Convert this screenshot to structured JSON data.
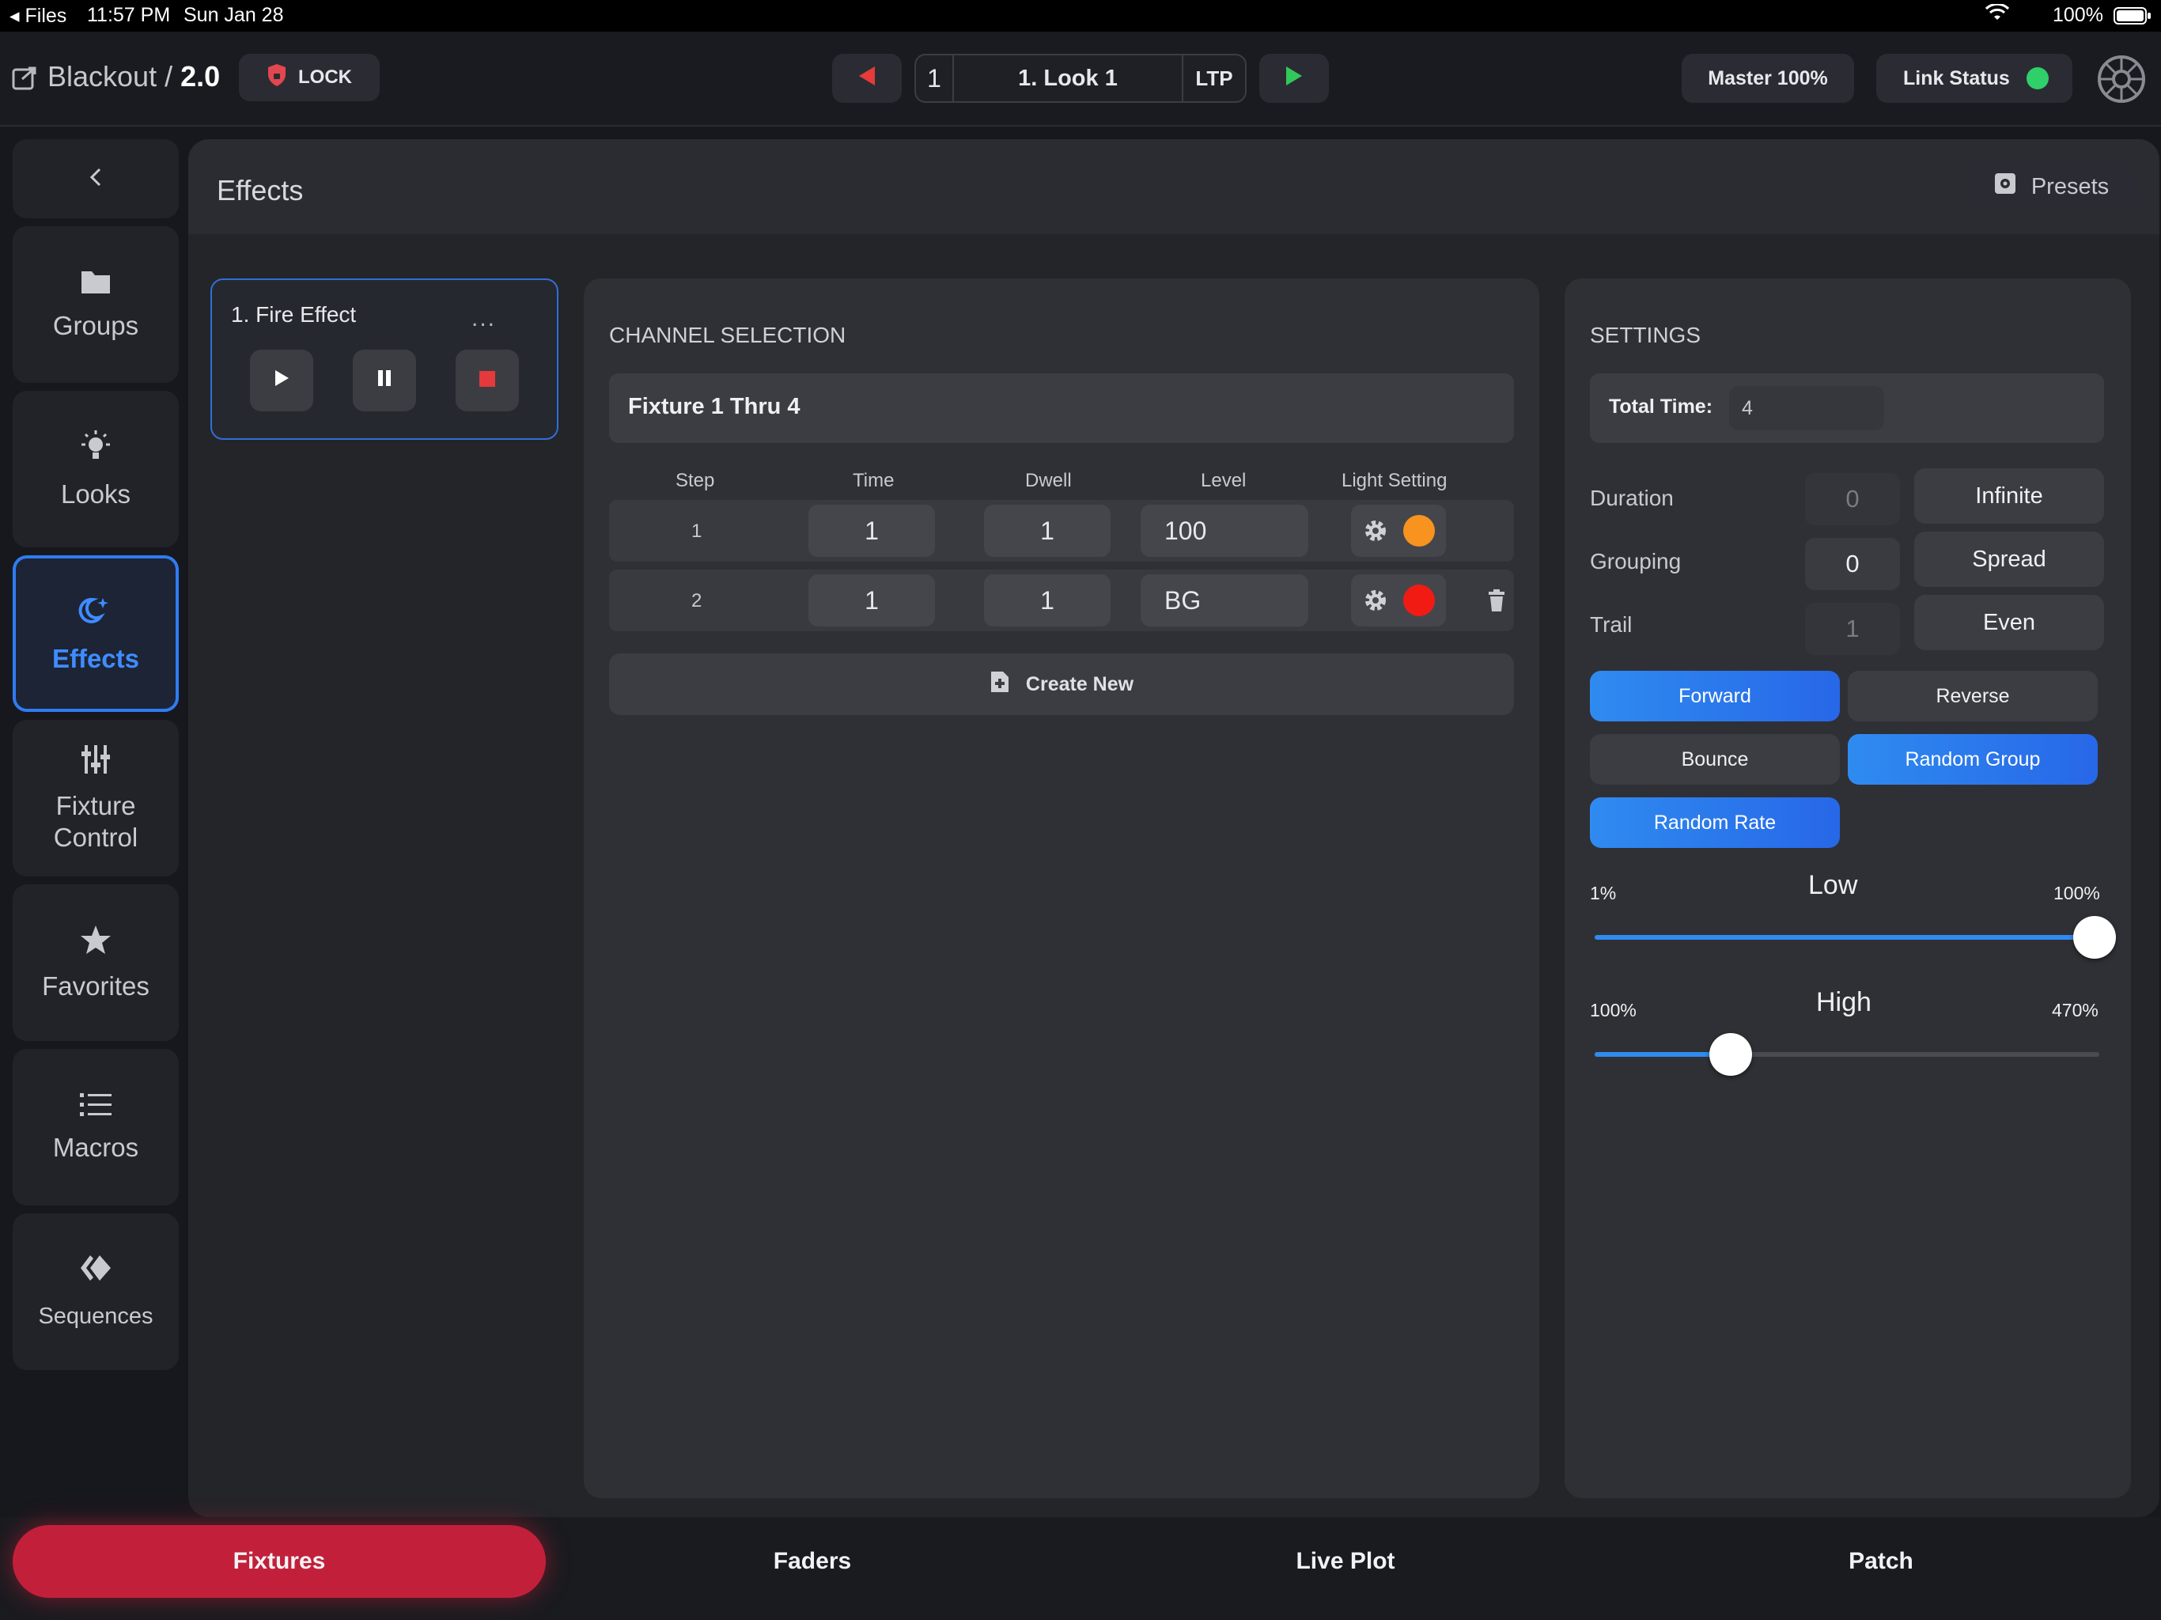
{
  "status_bar": {
    "back_app": "Files",
    "time": "11:57 PM",
    "date": "Sun Jan 28",
    "battery": "100%"
  },
  "header": {
    "title": "Blackout",
    "separator": "/",
    "version": "2.0",
    "lock_label": "LOCK",
    "cue_number": "1",
    "cue_name": "1. Look 1",
    "mode": "LTP",
    "master_label": "Master 100%",
    "link_label": "Link Status"
  },
  "sidebar": {
    "items": [
      {
        "label": "Groups"
      },
      {
        "label": "Looks"
      },
      {
        "label": "Effects"
      },
      {
        "label": "Fixture Control"
      },
      {
        "label": "Favorites"
      },
      {
        "label": "Macros"
      },
      {
        "label": "Sequences"
      }
    ]
  },
  "page": {
    "title": "Effects",
    "presets_label": "Presets"
  },
  "effect": {
    "name": "1. Fire Effect",
    "more": "..."
  },
  "channel_selection": {
    "heading": "CHANNEL SELECTION",
    "fixture_text": "Fixture 1 Thru 4",
    "columns": [
      "Step",
      "Time",
      "Dwell",
      "Level",
      "Light Setting"
    ],
    "rows": [
      {
        "step": "1",
        "time": "1",
        "dwell": "1",
        "level": "100",
        "color": "#f7931e"
      },
      {
        "step": "2",
        "time": "1",
        "dwell": "1",
        "level": "BG",
        "color": "#f21b13"
      }
    ],
    "create_label": "Create New"
  },
  "settings": {
    "heading": "SETTINGS",
    "total_time_label": "Total Time:",
    "total_time_value": "4",
    "duration_label": "Duration",
    "duration_value": "0",
    "grouping_label": "Grouping",
    "grouping_value": "0",
    "trail_label": "Trail",
    "trail_value": "1",
    "infinite_label": "Infinite",
    "spread_label": "Spread",
    "even_label": "Even",
    "forward_label": "Forward",
    "reverse_label": "Reverse",
    "bounce_label": "Bounce",
    "random_group_label": "Random Group",
    "random_rate_label": "Random Rate",
    "low": {
      "label": "Low",
      "min": "1%",
      "max": "100%",
      "value_fraction": 1.0
    },
    "high": {
      "label": "High",
      "min": "100%",
      "max": "470%",
      "value_fraction": 0.27
    }
  },
  "tabs": [
    "Fixtures",
    "Faders",
    "Live Plot",
    "Patch"
  ],
  "colors": {
    "accent_blue": "#2f7cf2",
    "active_tab": "#c2203a",
    "link_ok": "#2fd06a",
    "stop_red": "#e5393b",
    "prev_red": "#e53b3b",
    "next_green": "#33c85a"
  }
}
